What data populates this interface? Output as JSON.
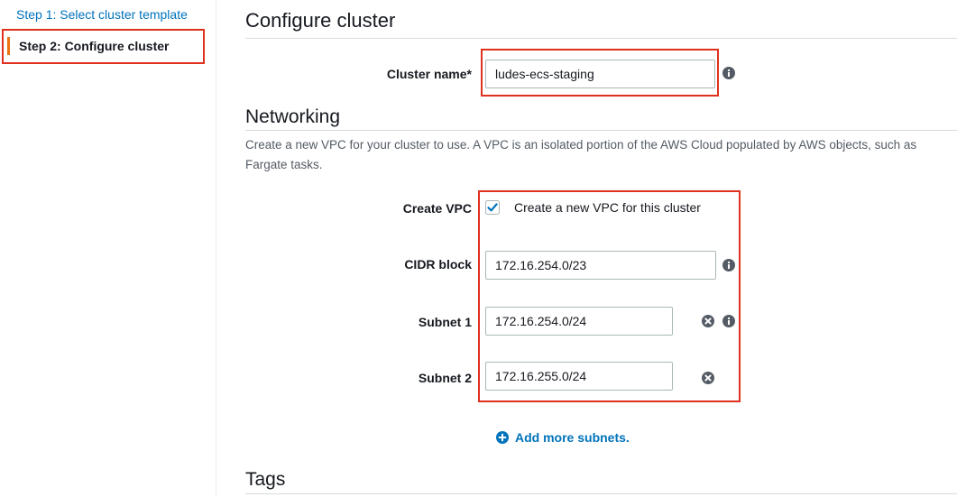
{
  "sidebar": {
    "step1": "Step 1: Select cluster template",
    "step2": "Step 2: Configure cluster"
  },
  "main": {
    "title": "Configure cluster",
    "cluster_name_label": "Cluster name*",
    "cluster_name_value": "ludes-ecs-staging",
    "networking": {
      "title": "Networking",
      "description": "Create a new VPC for your cluster to use. A VPC is an isolated portion of the AWS Cloud populated by AWS objects, such as Fargate tasks.",
      "create_vpc_label": "Create VPC",
      "create_vpc_checked": true,
      "create_vpc_text": "Create a new VPC for this cluster",
      "cidr_label": "CIDR block",
      "cidr_value": "172.16.254.0/23",
      "subnet1_label": "Subnet 1",
      "subnet1_value": "172.16.254.0/24",
      "subnet2_label": "Subnet 2",
      "subnet2_value": "172.16.255.0/24",
      "add_more": "Add more subnets."
    },
    "tags_title": "Tags"
  },
  "colors": {
    "link": "#0073bb",
    "highlight": "#e0301e",
    "active_step_accent": "#ec7211"
  }
}
